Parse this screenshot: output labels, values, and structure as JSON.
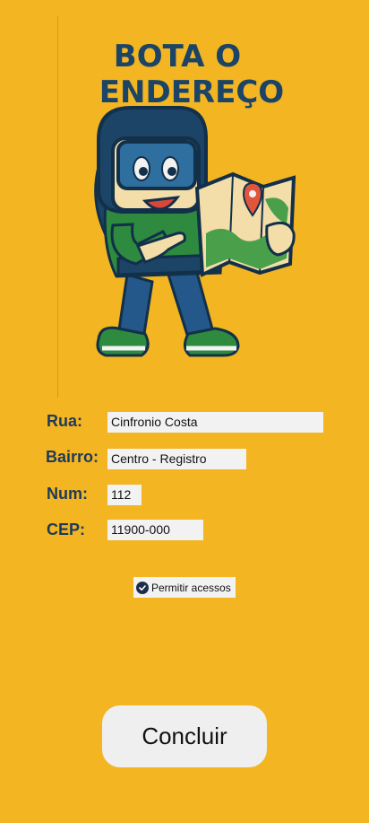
{
  "header": {
    "title_line1": "BOTA O",
    "title_line2": "ENDEREÇO",
    "mascot_icon": "mascot-holding-map-icon"
  },
  "form": {
    "rua_label": "Rua:",
    "rua_value": "Cinfronio Costa",
    "bairro_label": "Bairro:",
    "bairro_value": "Centro - Registro",
    "num_label": "Num:",
    "num_value": "112",
    "cep_label": "CEP:",
    "cep_value": "11900-000"
  },
  "permission": {
    "label": "Permitir acessos",
    "checked": true
  },
  "actions": {
    "submit_label": "Concluir"
  },
  "colors": {
    "background": "#F3B522",
    "label_text": "#1C3A5C",
    "input_bg": "#F2F2F2",
    "button_bg": "#EFEFEF"
  }
}
